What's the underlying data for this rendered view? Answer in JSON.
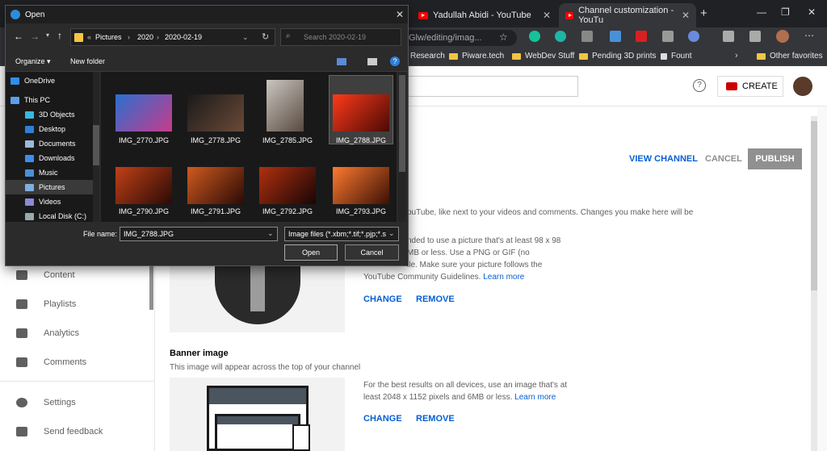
{
  "browser": {
    "tabs": [
      {
        "title": "Yadullah Abidi - YouTube",
        "active": false
      },
      {
        "title": "Channel customization - YouTu",
        "active": true
      }
    ],
    "new_tab": "+",
    "address_fragment": "Glw/editing/imag...",
    "bookmarks": [
      "Research",
      "Piware.tech",
      "WebDev Stuff",
      "Pending 3D prints",
      "Fount"
    ],
    "other_favorites": "Other favorites"
  },
  "youtube": {
    "create_label": "CREATE",
    "view_channel": "VIEW CHANNEL",
    "cancel": "CANCEL",
    "publish": "PUBLISH",
    "sidebar": [
      {
        "label": "Content",
        "icon": "content-icon"
      },
      {
        "label": "Playlists",
        "icon": "playlists-icon"
      },
      {
        "label": "Analytics",
        "icon": "analytics-icon"
      },
      {
        "label": "Comments",
        "icon": "comments-icon"
      },
      {
        "label": "Settings",
        "icon": "gear-icon"
      },
      {
        "label": "Send feedback",
        "icon": "feedback-icon"
      }
    ],
    "picture": {
      "intro": "ouTube, like next to your videos and comments. Changes you make here will be",
      "line1": "nded to use a picture that's at least 98 x 98",
      "line2": "MB or less. Use a PNG or GIF (no",
      "line3": "ile. Make sure your picture follows the",
      "line4": "YouTube Community Guidelines.",
      "learn_more": "Learn more",
      "change": "CHANGE",
      "remove": "REMOVE"
    },
    "banner": {
      "title": "Banner image",
      "subtitle": "This image will appear across the top of your channel",
      "line1": "For the best results on all devices, use an image that's at",
      "line2": "least 2048 x 1152 pixels and 6MB or less.",
      "learn_more": "Learn more",
      "change": "CHANGE",
      "remove": "REMOVE"
    }
  },
  "dialog": {
    "title": "Open",
    "path": [
      "Pictures",
      "2020",
      "2020-02-19"
    ],
    "search_placeholder": "Search 2020-02-19",
    "organize": "Organize ▾",
    "new_folder": "New folder",
    "tree": [
      {
        "label": "OneDrive",
        "color": "#2f8fe8"
      },
      {
        "label": "This PC",
        "color": "#5aa0e8"
      },
      {
        "label": "3D Objects",
        "color": "#39b8e0"
      },
      {
        "label": "Desktop",
        "color": "#2f7fd8"
      },
      {
        "label": "Documents",
        "color": "#9fb8d8"
      },
      {
        "label": "Downloads",
        "color": "#3a8fe8"
      },
      {
        "label": "Music",
        "color": "#4a90d9"
      },
      {
        "label": "Pictures",
        "color": "#7bb0e0"
      },
      {
        "label": "Videos",
        "color": "#8a8ad8"
      },
      {
        "label": "Local Disk (C:)",
        "color": "#9aa"
      }
    ],
    "files": [
      {
        "name": "IMG_2770.JPG",
        "colors": [
          "#2a6fd0",
          "#c83b8a"
        ]
      },
      {
        "name": "IMG_2778.JPG",
        "colors": [
          "#1a1a1a",
          "#6b4a38"
        ]
      },
      {
        "name": "IMG_2785.JPG",
        "colors": [
          "#c9c6c0",
          "#5a4a40"
        ]
      },
      {
        "name": "IMG_2788.JPG",
        "colors": [
          "#ff3a1a",
          "#4a0a05"
        ]
      },
      {
        "name": "IMG_2790.JPG",
        "colors": [
          "#c04018",
          "#2a0a05"
        ]
      },
      {
        "name": "IMG_2791.JPG",
        "colors": [
          "#d05a20",
          "#2a0a05"
        ]
      },
      {
        "name": "IMG_2792.JPG",
        "colors": [
          "#b03010",
          "#180505"
        ]
      },
      {
        "name": "IMG_2793.JPG",
        "colors": [
          "#ff7a30",
          "#3a1005"
        ]
      }
    ],
    "file_name_label": "File name:",
    "file_name_value": "IMG_2788.JPG",
    "file_type": "Image files (*.xbm;*.tif;*.pjp;*.s",
    "open": "Open",
    "cancel": "Cancel"
  }
}
